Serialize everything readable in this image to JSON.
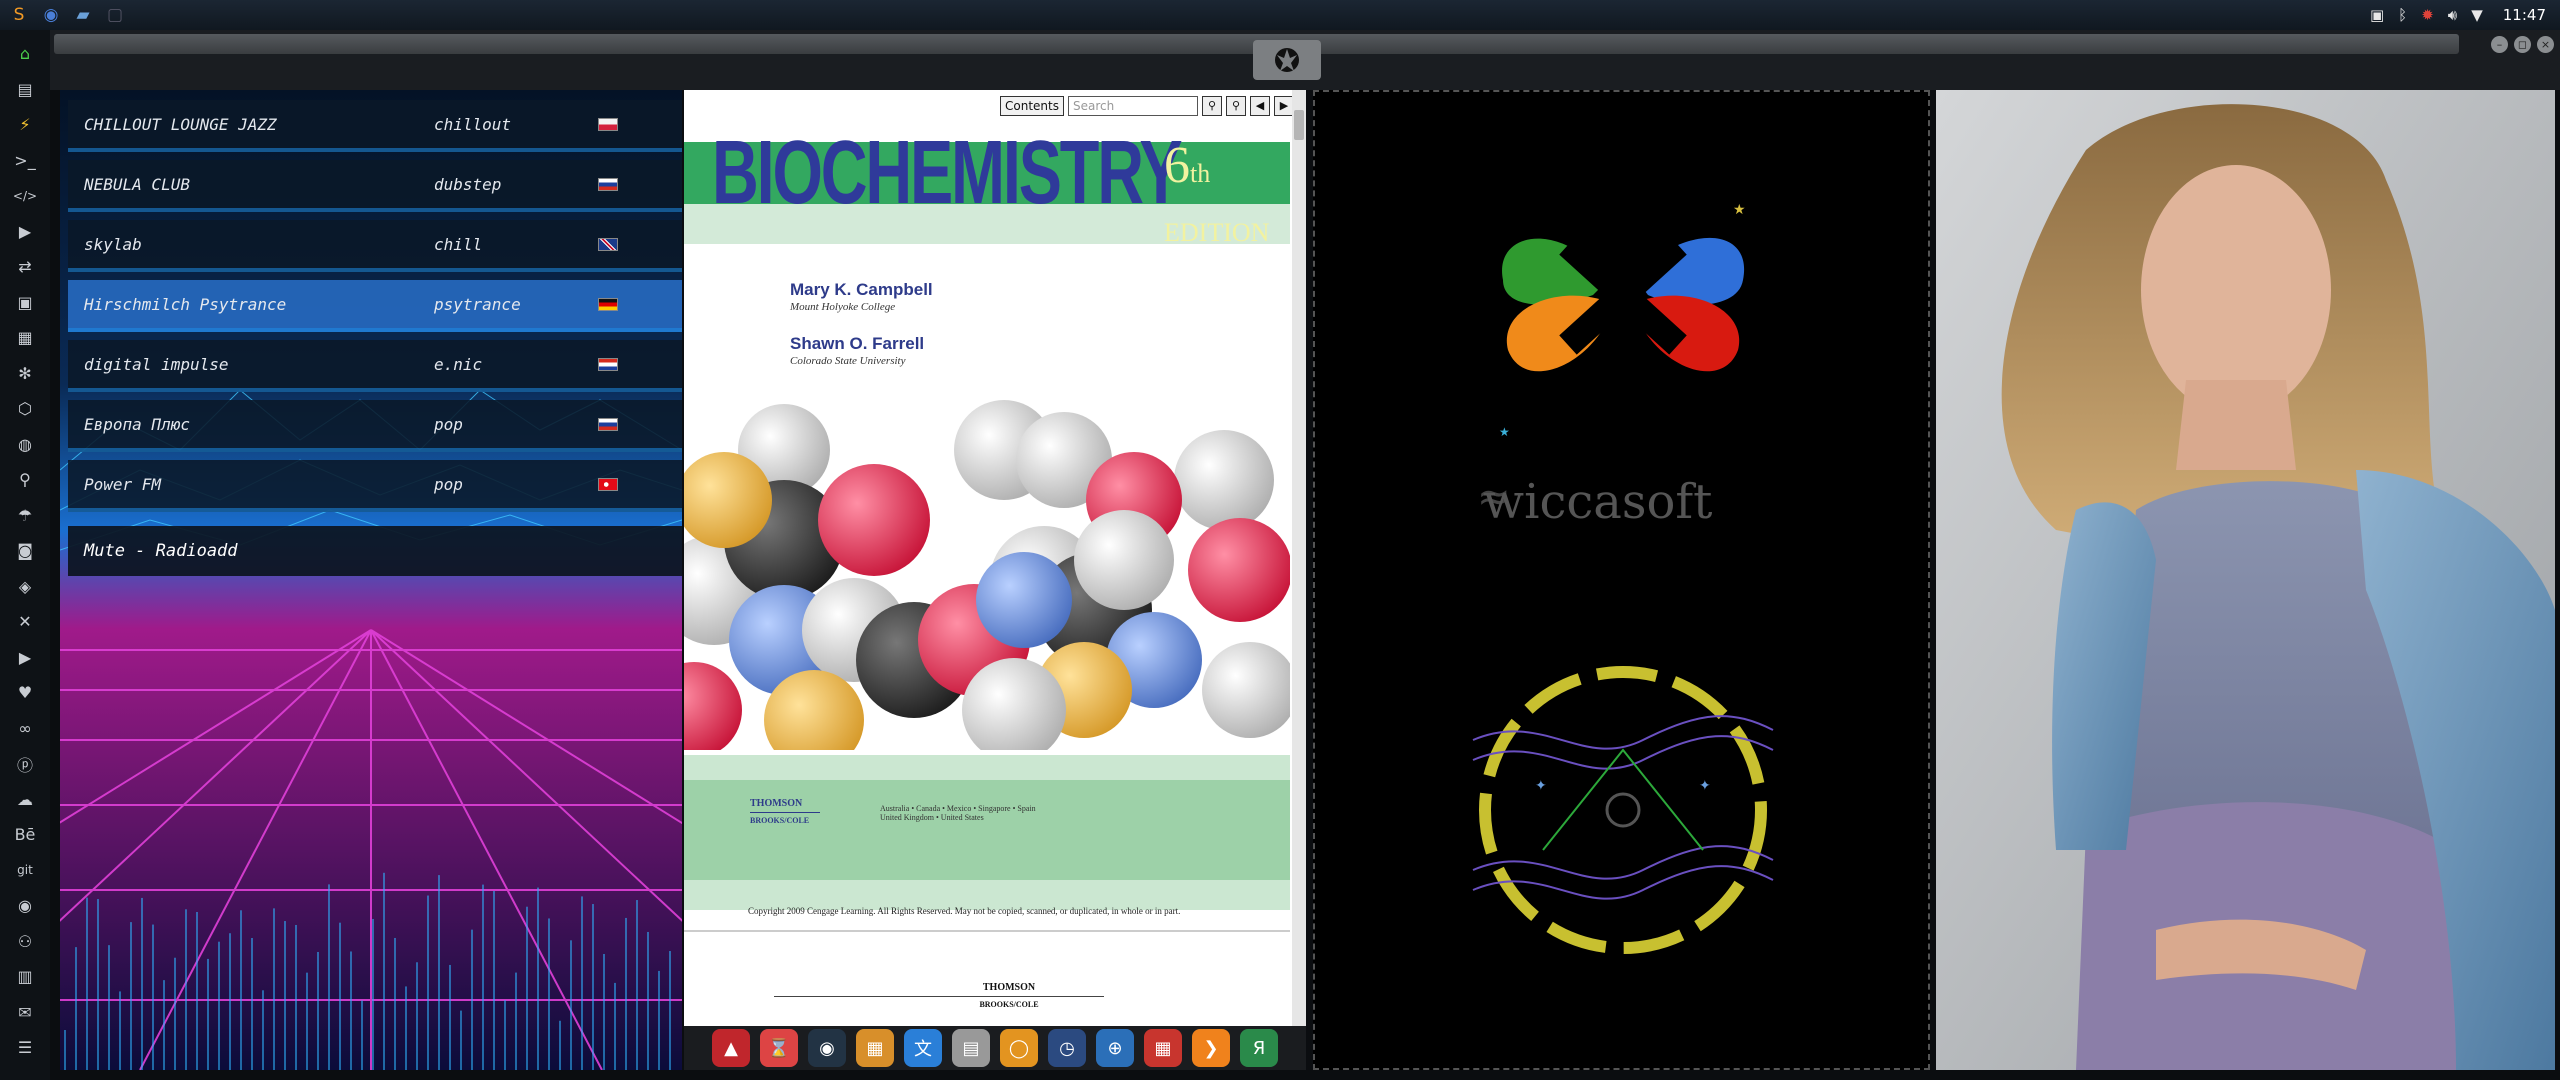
{
  "topbar": {
    "apps": [
      {
        "icon": "sublime-icon",
        "color": "#f29a25"
      },
      {
        "icon": "chromium-icon",
        "color": "#4a7fd8"
      },
      {
        "icon": "folder-icon",
        "color": "#6aa0d8"
      },
      {
        "icon": "window-icon",
        "color": "#556"
      }
    ],
    "tray_icons": [
      "screenshot-icon",
      "bluetooth-icon",
      "settings-icon",
      "volume-icon",
      "wifi-icon"
    ],
    "clock": "11:47"
  },
  "left_dock": {
    "items": [
      {
        "icon": "home-icon",
        "glyph": "⌂"
      },
      {
        "icon": "document-icon",
        "glyph": "▤"
      },
      {
        "icon": "bolt-icon",
        "glyph": "⚡"
      },
      {
        "icon": "terminal-icon",
        "glyph": ">_"
      },
      {
        "icon": "code-icon",
        "glyph": "</>"
      },
      {
        "icon": "play-icon",
        "glyph": "▶"
      },
      {
        "icon": "translate-icon",
        "glyph": "⇄"
      },
      {
        "icon": "image-icon",
        "glyph": "▣"
      },
      {
        "icon": "news-icon",
        "glyph": "▦"
      },
      {
        "icon": "react-icon",
        "glyph": "✻"
      },
      {
        "icon": "hexagon-icon",
        "glyph": "⬡"
      },
      {
        "icon": "globe-icon",
        "glyph": "◍"
      },
      {
        "icon": "search-icon",
        "glyph": "⚲"
      },
      {
        "icon": "umbrella-icon",
        "glyph": "☂"
      },
      {
        "icon": "contact-icon",
        "glyph": "◙"
      },
      {
        "icon": "diamond-icon",
        "glyph": "◈"
      },
      {
        "icon": "tools-icon",
        "glyph": "✕"
      },
      {
        "icon": "youtube-icon",
        "glyph": "▶"
      },
      {
        "icon": "heart-icon",
        "glyph": "♥"
      },
      {
        "icon": "infinity-icon",
        "glyph": "∞"
      },
      {
        "icon": "pinterest-icon",
        "glyph": "ⓟ"
      },
      {
        "icon": "cloud-icon",
        "glyph": "☁"
      },
      {
        "icon": "behance-icon",
        "glyph": "Bē"
      },
      {
        "icon": "git-icon",
        "glyph": "git"
      },
      {
        "icon": "github-icon",
        "glyph": "◉"
      },
      {
        "icon": "people-icon",
        "glyph": "⚇"
      },
      {
        "icon": "map-icon",
        "glyph": "▥"
      },
      {
        "icon": "mail-icon",
        "glyph": "✉"
      },
      {
        "icon": "list-icon",
        "glyph": "☰"
      }
    ]
  },
  "window": {
    "buttons": [
      "minimize",
      "maximize",
      "close"
    ]
  },
  "radio": {
    "stations": [
      {
        "name": "CHILLOUT LOUNGE JAZZ",
        "genre": "chillout",
        "flag": "pl",
        "active": false
      },
      {
        "name": "NEBULA CLUB",
        "genre": "dubstep",
        "flag": "ru",
        "active": false
      },
      {
        "name": "skylab",
        "genre": "chill",
        "flag": "gb",
        "active": false
      },
      {
        "name": "Hirschmilch Psytrance",
        "genre": "psytrance",
        "flag": "de",
        "active": true
      },
      {
        "name": "digital impulse",
        "genre": "e.nic",
        "flag": "hr",
        "active": false
      },
      {
        "name": "Европа Плюс",
        "genre": "pop",
        "flag": "ru",
        "active": false
      },
      {
        "name": "Power FM",
        "genre": "pop",
        "flag": "tr",
        "active": false
      }
    ],
    "now_playing": "Mute - Radioadd"
  },
  "book": {
    "toolbar": {
      "contents_label": "Contents",
      "search_placeholder": "Search"
    },
    "title": "BIOCHEMISTRY",
    "edition_num": "6",
    "edition_suffix": "th",
    "edition_word": "EDITION",
    "authors": [
      {
        "name": "Mary K. Campbell",
        "affiliation": "Mount Holyoke College"
      },
      {
        "name": "Shawn O. Farrell",
        "affiliation": "Colorado State University"
      }
    ],
    "publisher_line1": "THOMSON",
    "publisher_line2": "BROOKS/COLE",
    "locations_line1": "Australia • Canada • Mexico • Singapore • Spain",
    "locations_line2": "United Kingdom • United States",
    "copyright": "Copyright 2009 Cengage Learning. All Rights Reserved. May not be copied, scanned, or duplicated, in whole or in part.",
    "page2_publisher_line1": "THOMSON",
    "page2_publisher_line2": "BROOKS/COLE"
  },
  "brand": {
    "name": "wiccasoft",
    "petal_colors": [
      "#2f9a2f",
      "#2f6fd8",
      "#f08a1a",
      "#d81a10"
    ]
  },
  "dock": {
    "apps": [
      {
        "icon": "red-triangle-app-icon",
        "color": "#c0262c"
      },
      {
        "icon": "hourglass-app-icon",
        "color": "#d44"
      },
      {
        "icon": "planet-app-icon",
        "color": "#234"
      },
      {
        "icon": "photos-app-icon",
        "color": "#d88f2a"
      },
      {
        "icon": "translator-app-icon",
        "color": "#2a7fd8"
      },
      {
        "icon": "news-app-icon",
        "color": "#999"
      },
      {
        "icon": "search-app-icon",
        "color": "#e39420"
      },
      {
        "icon": "clock-app-icon",
        "color": "#2b4a80"
      },
      {
        "icon": "globe-app-icon",
        "color": "#2b6fb8"
      },
      {
        "icon": "calendar-app-icon",
        "color": "#c8352e"
      },
      {
        "icon": "sublime-app-icon",
        "color": "#f0821c"
      },
      {
        "icon": "yandex-app-icon",
        "color": "#2a8a4a"
      }
    ]
  }
}
